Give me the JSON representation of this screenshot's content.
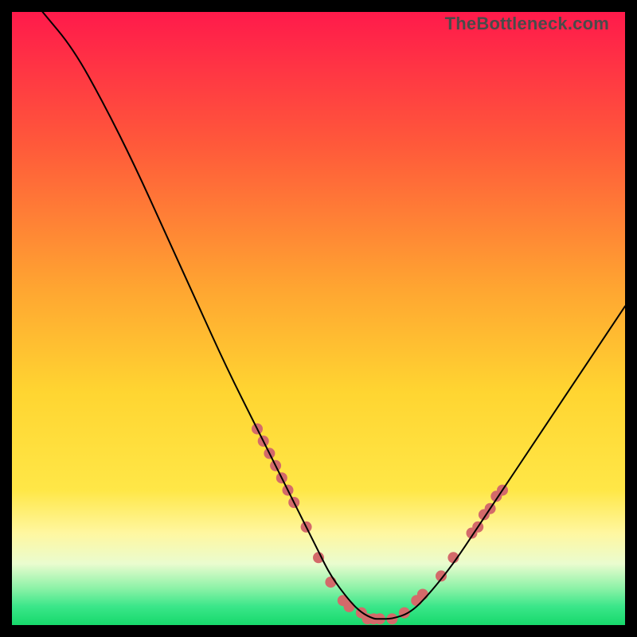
{
  "watermark": "TheBottleneck.com",
  "chart_data": {
    "type": "line",
    "title": "",
    "xlabel": "",
    "ylabel": "",
    "xlim": [
      0,
      100
    ],
    "ylim": [
      0,
      100
    ],
    "grid": false,
    "legend": false,
    "background_gradient": {
      "stops": [
        {
          "offset": 0.0,
          "color": "#ff1a4b"
        },
        {
          "offset": 0.22,
          "color": "#ff5a3a"
        },
        {
          "offset": 0.45,
          "color": "#ffa531"
        },
        {
          "offset": 0.62,
          "color": "#ffd531"
        },
        {
          "offset": 0.78,
          "color": "#ffe747"
        },
        {
          "offset": 0.85,
          "color": "#fff7a0"
        },
        {
          "offset": 0.9,
          "color": "#eafccf"
        },
        {
          "offset": 0.94,
          "color": "#8cf2a7"
        },
        {
          "offset": 0.97,
          "color": "#3ae689"
        },
        {
          "offset": 1.0,
          "color": "#17d96b"
        }
      ]
    },
    "series": [
      {
        "name": "bottleneck-curve",
        "color": "#000000",
        "stroke_width": 2,
        "x": [
          5,
          10,
          15,
          20,
          25,
          30,
          35,
          40,
          45,
          48,
          50,
          52,
          55,
          57,
          59,
          60,
          62,
          65,
          68,
          72,
          76,
          80,
          84,
          88,
          92,
          96,
          100
        ],
        "y": [
          100,
          94,
          85,
          75,
          64,
          53,
          42,
          32,
          22,
          16,
          12,
          8,
          4,
          2,
          1,
          1,
          1,
          2,
          5,
          10,
          16,
          22,
          28,
          34,
          40,
          46,
          52
        ]
      }
    ],
    "markers": {
      "name": "highlight-dots",
      "color": "#d36a6a",
      "radius": 7,
      "points": [
        {
          "x": 40,
          "y": 32
        },
        {
          "x": 41,
          "y": 30
        },
        {
          "x": 42,
          "y": 28
        },
        {
          "x": 43,
          "y": 26
        },
        {
          "x": 44,
          "y": 24
        },
        {
          "x": 45,
          "y": 22
        },
        {
          "x": 46,
          "y": 20
        },
        {
          "x": 48,
          "y": 16
        },
        {
          "x": 50,
          "y": 11
        },
        {
          "x": 52,
          "y": 7
        },
        {
          "x": 54,
          "y": 4
        },
        {
          "x": 55,
          "y": 3
        },
        {
          "x": 57,
          "y": 2
        },
        {
          "x": 58,
          "y": 1
        },
        {
          "x": 59,
          "y": 1
        },
        {
          "x": 60,
          "y": 1
        },
        {
          "x": 62,
          "y": 1
        },
        {
          "x": 64,
          "y": 2
        },
        {
          "x": 66,
          "y": 4
        },
        {
          "x": 67,
          "y": 5
        },
        {
          "x": 70,
          "y": 8
        },
        {
          "x": 72,
          "y": 11
        },
        {
          "x": 75,
          "y": 15
        },
        {
          "x": 76,
          "y": 16
        },
        {
          "x": 77,
          "y": 18
        },
        {
          "x": 78,
          "y": 19
        },
        {
          "x": 79,
          "y": 21
        },
        {
          "x": 80,
          "y": 22
        }
      ]
    }
  }
}
